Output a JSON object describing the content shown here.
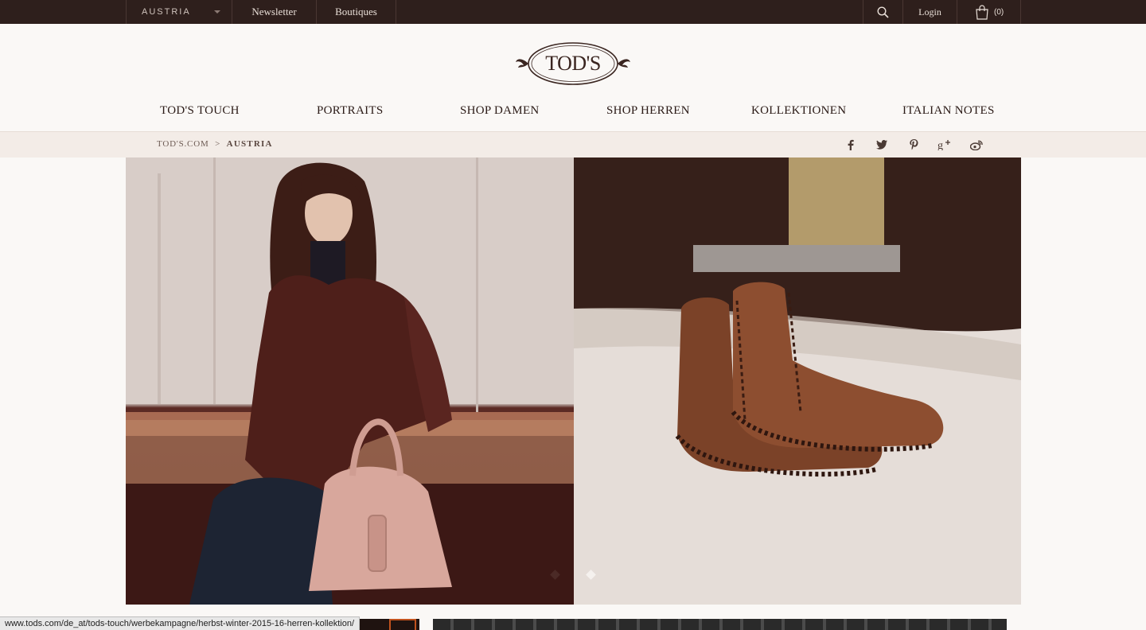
{
  "topbar": {
    "country": "AUSTRIA",
    "newsletter": "Newsletter",
    "boutiques": "Boutiques",
    "login": "Login",
    "cart_count": "(0)",
    "icons": [
      "search-icon",
      "shopping-bag-icon",
      "chevron-down-icon"
    ]
  },
  "brand": {
    "logo_text": "TOD'S"
  },
  "nav": {
    "items": [
      "TOD'S TOUCH",
      "PORTRAITS",
      "SHOP DAMEN",
      "SHOP HERREN",
      "KOLLEKTIONEN",
      "ITALIAN NOTES"
    ]
  },
  "breadcrumb": {
    "root": "TOD'S.COM",
    "separator": ">",
    "current": "AUSTRIA"
  },
  "social": {
    "icons": [
      "facebook-icon",
      "twitter-icon",
      "pinterest-icon",
      "google-plus-icon",
      "weibo-icon"
    ]
  },
  "carousel": {
    "slides": 2,
    "active_index": 1
  },
  "status_url": "www.tods.com/de_at/tods-touch/werbekampagne/herbst-winter-2015-16-herren-kollektion/",
  "colors": {
    "topbar": "#2e1f1c",
    "page": "#faf8f6",
    "crumb_bar": "#f3ece7",
    "accent_orange": "#c0521e"
  }
}
